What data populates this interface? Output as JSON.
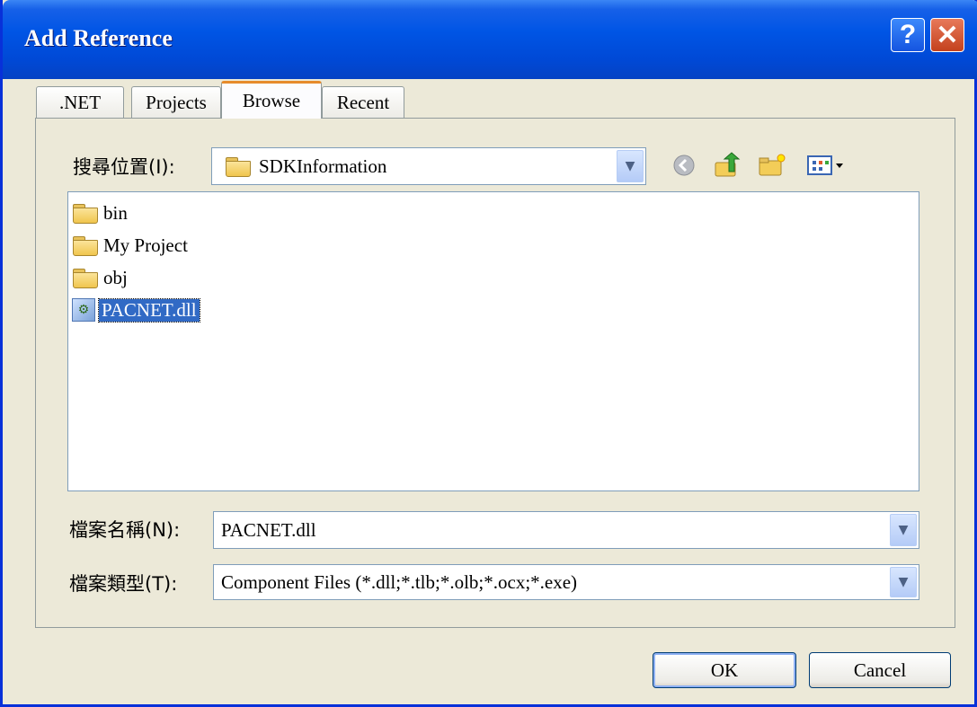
{
  "window": {
    "title": "Add Reference",
    "help_glyph": "?",
    "close_glyph": "✕"
  },
  "tabs": [
    {
      "label": ".NET",
      "active": false
    },
    {
      "label": "Projects",
      "active": false
    },
    {
      "label": "Browse",
      "active": true
    },
    {
      "label": "Recent",
      "active": false
    }
  ],
  "look_in": {
    "label": "搜尋位置(I):",
    "value": "SDKInformation"
  },
  "toolbar": {
    "icons": [
      "back-icon",
      "up-folder-icon",
      "new-folder-icon",
      "view-menu-icon"
    ]
  },
  "file_list": {
    "items": [
      {
        "name": "bin",
        "type": "folder"
      },
      {
        "name": "My Project",
        "type": "folder"
      },
      {
        "name": "obj",
        "type": "folder"
      },
      {
        "name": "PACNET.dll",
        "type": "dll",
        "selected": true
      }
    ]
  },
  "file_name": {
    "label": "檔案名稱(N):",
    "value": "PACNET.dll"
  },
  "file_type": {
    "label": "檔案類型(T):",
    "value": "Component Files (*.dll;*.tlb;*.olb;*.ocx;*.exe)"
  },
  "buttons": {
    "ok": "OK",
    "cancel": "Cancel"
  },
  "colors": {
    "titlebar": "#0055e5",
    "selection": "#316ac5",
    "active_tab_accent": "#e68b2c",
    "dialog_bg": "#ece9d8"
  }
}
